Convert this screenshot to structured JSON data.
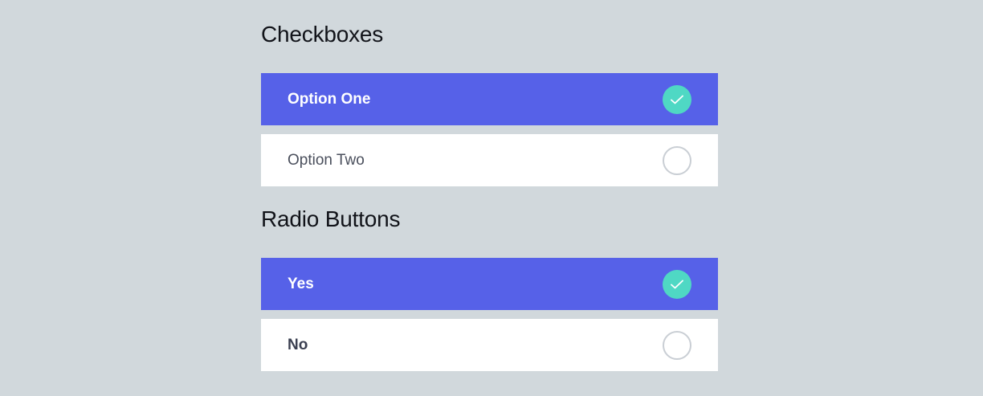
{
  "checkboxes": {
    "title": "Checkboxes",
    "items": [
      {
        "label": "Option One",
        "checked": true
      },
      {
        "label": "Option Two",
        "checked": false
      }
    ]
  },
  "radios": {
    "title": "Radio Buttons",
    "items": [
      {
        "label": "Yes",
        "checked": true
      },
      {
        "label": "No",
        "checked": false
      }
    ]
  },
  "colors": {
    "background": "#d1d8dc",
    "selected_bg": "#5661e8",
    "check_accent": "#4fd8c4",
    "unselected_bg": "#ffffff"
  },
  "icons": {
    "checked": "check-icon",
    "unchecked": "empty-circle-icon"
  }
}
